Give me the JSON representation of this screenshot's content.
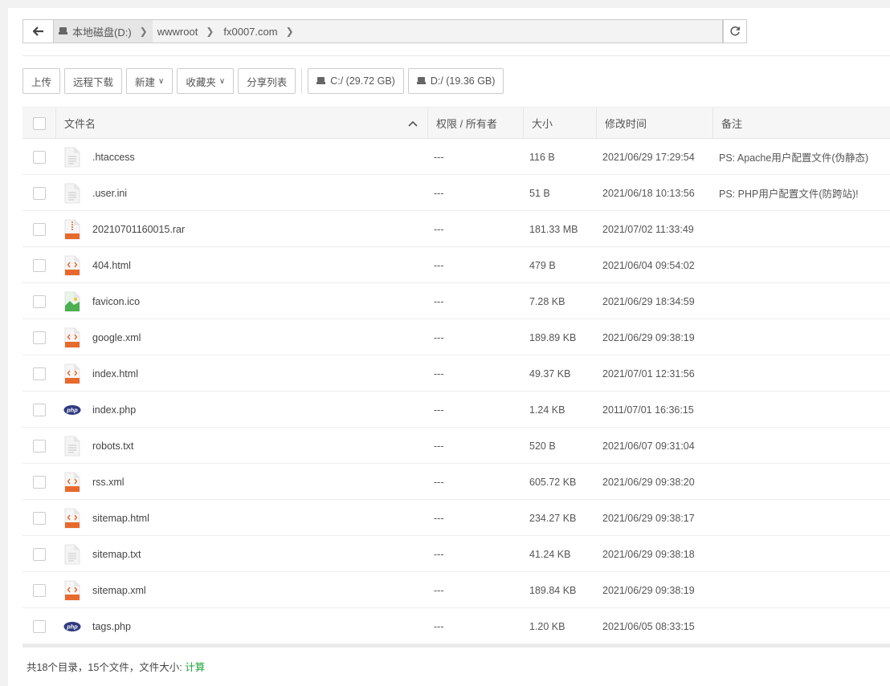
{
  "breadcrumb": {
    "items": [
      "本地磁盘(D:)",
      "wwwroot",
      "fx0007.com"
    ]
  },
  "toolbar": {
    "upload": "上传",
    "remote_download": "远程下载",
    "new": "新建",
    "favorites": "收藏夹",
    "share_list": "分享列表",
    "disk_c": "C:/ (29.72 GB)",
    "disk_d": "D:/ (19.36 GB)"
  },
  "table": {
    "headers": {
      "name": "文件名",
      "perm": "权限 / 所有者",
      "size": "大小",
      "mtime": "修改时间",
      "note": "备注"
    },
    "rows": [
      {
        "name": ".htaccess",
        "icon": "text-file-icon",
        "perm": "---",
        "size": "116 B",
        "mtime": "2021/06/29 17:29:54",
        "note": "PS: Apache用户配置文件(伪静态)"
      },
      {
        "name": ".user.ini",
        "icon": "text-file-icon",
        "perm": "---",
        "size": "51 B",
        "mtime": "2021/06/18 10:13:56",
        "note": "PS: PHP用户配置文件(防跨站)!"
      },
      {
        "name": "20210701160015.rar",
        "icon": "rar-file-icon",
        "perm": "---",
        "size": "181.33 MB",
        "mtime": "2021/07/02 11:33:49",
        "note": ""
      },
      {
        "name": "404.html",
        "icon": "html-file-icon",
        "perm": "---",
        "size": "479 B",
        "mtime": "2021/06/04 09:54:02",
        "note": ""
      },
      {
        "name": "favicon.ico",
        "icon": "ico-file-icon",
        "perm": "---",
        "size": "7.28 KB",
        "mtime": "2021/06/29 18:34:59",
        "note": ""
      },
      {
        "name": "google.xml",
        "icon": "xml-file-icon",
        "perm": "---",
        "size": "189.89 KB",
        "mtime": "2021/06/29 09:38:19",
        "note": ""
      },
      {
        "name": "index.html",
        "icon": "html-file-icon",
        "perm": "---",
        "size": "49.37 KB",
        "mtime": "2021/07/01 12:31:56",
        "note": ""
      },
      {
        "name": "index.php",
        "icon": "php-file-icon",
        "perm": "---",
        "size": "1.24 KB",
        "mtime": "2011/07/01 16:36:15",
        "note": ""
      },
      {
        "name": "robots.txt",
        "icon": "text-file-icon",
        "perm": "---",
        "size": "520 B",
        "mtime": "2021/06/07 09:31:04",
        "note": ""
      },
      {
        "name": "rss.xml",
        "icon": "xml-file-icon",
        "perm": "---",
        "size": "605.72 KB",
        "mtime": "2021/06/29 09:38:20",
        "note": ""
      },
      {
        "name": "sitemap.html",
        "icon": "html-file-icon",
        "perm": "---",
        "size": "234.27 KB",
        "mtime": "2021/06/29 09:38:17",
        "note": ""
      },
      {
        "name": "sitemap.txt",
        "icon": "text-file-icon",
        "perm": "---",
        "size": "41.24 KB",
        "mtime": "2021/06/29 09:38:18",
        "note": ""
      },
      {
        "name": "sitemap.xml",
        "icon": "xml-file-icon",
        "perm": "---",
        "size": "189.84 KB",
        "mtime": "2021/06/29 09:38:19",
        "note": ""
      },
      {
        "name": "tags.php",
        "icon": "php-file-icon",
        "perm": "---",
        "size": "1.20 KB",
        "mtime": "2021/06/05 08:33:15",
        "note": ""
      }
    ]
  },
  "footer": {
    "summary": "共18个目录，15个文件，文件大小:",
    "calc_link": "计算"
  },
  "colors": {
    "accent_green": "#20a53a",
    "file_orange": "#e8692c",
    "php_navy": "#2f3a80"
  }
}
